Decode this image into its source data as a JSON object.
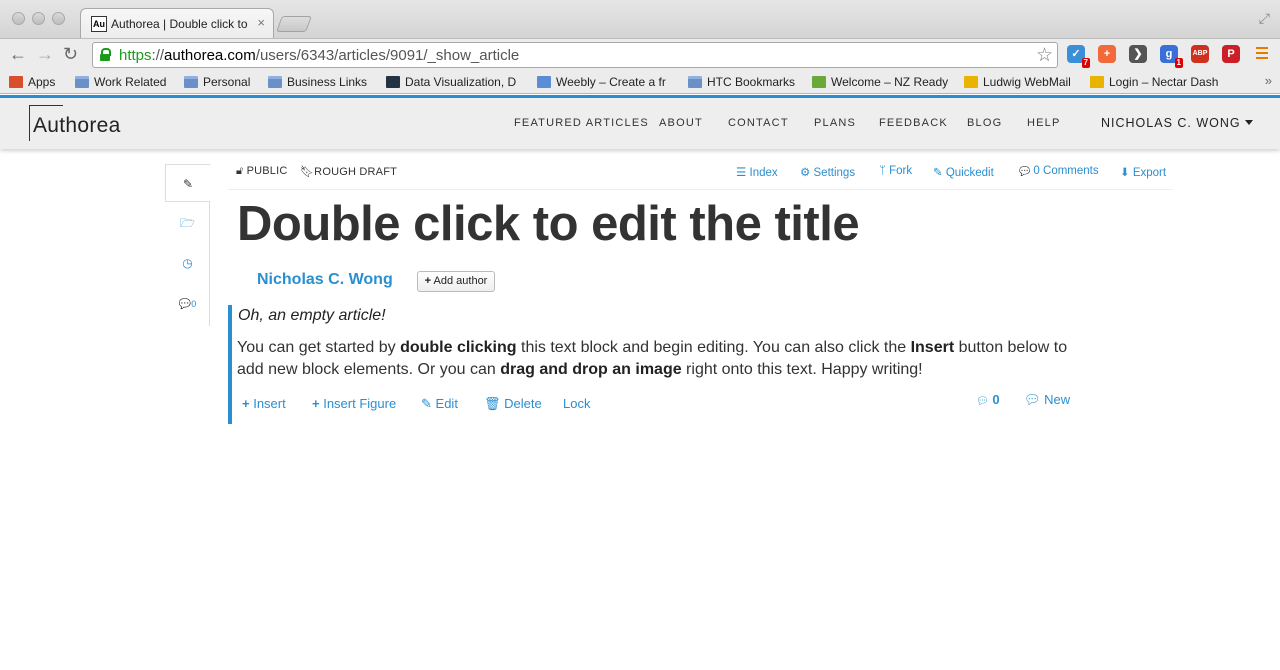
{
  "browser": {
    "tab_title": "Authorea | Double click to edit the title",
    "tab_favicon": "Au",
    "url_scheme": "https",
    "url_separator": "://",
    "url_host": "authorea.com",
    "url_path": "/users/6343/articles/9091/_show_article",
    "extensions": [
      {
        "name": "todo-check-icon",
        "color": "#3a8fd8",
        "glyph": "✓",
        "badge": "7"
      },
      {
        "name": "plus-extension-icon",
        "color": "#f26a3a",
        "glyph": "+",
        "badge": ""
      },
      {
        "name": "pocket-icon",
        "color": "#555555",
        "glyph": "❯",
        "badge": ""
      },
      {
        "name": "google-plus-icon",
        "color": "#3b6fd8",
        "glyph": "g",
        "badge": "1"
      },
      {
        "name": "adblock-plus-icon",
        "color": "#d0301e",
        "glyph": "ABP",
        "badge": ""
      },
      {
        "name": "pinterest-icon",
        "color": "#cb2027",
        "glyph": "P",
        "badge": ""
      }
    ],
    "bookmarks": [
      {
        "label": "Apps",
        "icon": "apps-grid-icon",
        "color": "#d94e2b"
      },
      {
        "label": "Work Related",
        "icon": "folder-icon",
        "color": "#6b8fc7"
      },
      {
        "label": "Personal",
        "icon": "folder-icon",
        "color": "#6b8fc7"
      },
      {
        "label": "Business Links",
        "icon": "folder-icon",
        "color": "#6b8fc7"
      },
      {
        "label": "Data Visualization, D",
        "icon": "data-viz-icon",
        "color": "#234"
      },
      {
        "label": "Weebly – Create a fr",
        "icon": "weebly-icon",
        "color": "#5a8dd6"
      },
      {
        "label": "HTC Bookmarks",
        "icon": "folder-icon",
        "color": "#6b8fc7"
      },
      {
        "label": "Welcome – NZ Ready",
        "icon": "nz-ready-icon",
        "color": "#6aa83a"
      },
      {
        "label": "Ludwig WebMail",
        "icon": "webmail-icon",
        "color": "#e8b400"
      },
      {
        "label": "Login – Nectar Dash",
        "icon": "nectar-icon",
        "color": "#e8b400"
      }
    ],
    "bookmarks_more": "»"
  },
  "app": {
    "logo": "Authorea",
    "nav": [
      "FEATURED ARTICLES",
      "ABOUT",
      "CONTACT",
      "PLANS",
      "FEEDBACK",
      "BLOG",
      "HELP"
    ],
    "user_name": "NICHOLAS C. WONG",
    "accent_color": "#2a8fd1"
  },
  "sidebar": {
    "tabs": [
      {
        "name": "edit-pencil-icon",
        "glyph": "✎"
      },
      {
        "name": "folder-open-icon",
        "glyph": "🗁"
      },
      {
        "name": "history-clock-icon",
        "glyph": "◷"
      },
      {
        "name": "comments-icon",
        "glyph": "💬",
        "count": "0"
      }
    ]
  },
  "article": {
    "visibility": "PUBLIC",
    "status": "ROUGH DRAFT",
    "actions": [
      {
        "label": "Index",
        "icon": "list-icon",
        "glyph": "☰"
      },
      {
        "label": "Settings",
        "icon": "cogs-icon",
        "glyph": "⚙"
      },
      {
        "label": "Fork",
        "icon": "fork-icon",
        "glyph": "ᛘ"
      },
      {
        "label": "Quickedit",
        "icon": "edit-square-icon",
        "glyph": "✎"
      },
      {
        "label": "0 Comments",
        "icon": "comments-icon",
        "glyph": "💬"
      },
      {
        "label": "Export",
        "icon": "download-icon",
        "glyph": "⬇"
      }
    ],
    "title": "Double click to edit the title",
    "author": "Nicholas C. Wong",
    "add_author": "Add author",
    "block": {
      "lead": "Oh, an empty article!",
      "body_1": "You can get started by ",
      "body_b1": "double clicking",
      "body_2": " this text block and begin editing. You can also click the ",
      "body_b2": "Insert",
      "body_3": " button below to add new block elements. Or you can ",
      "body_b3": "drag and drop an image",
      "body_4": " right onto this text. Happy writing!",
      "actions": [
        "Insert",
        "Insert Figure",
        "Edit",
        "Delete",
        "Lock"
      ],
      "comment_count": "0",
      "new_label": "New"
    }
  }
}
